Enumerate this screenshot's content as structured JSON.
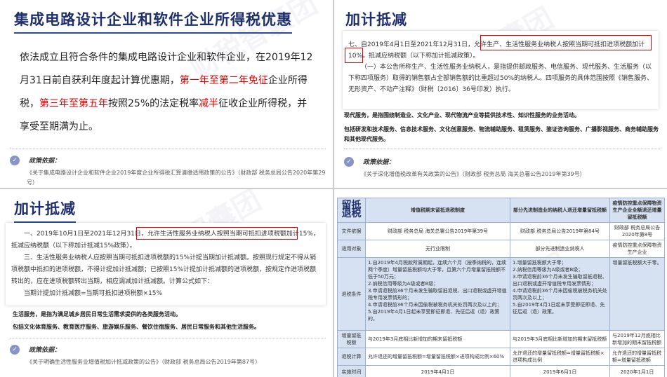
{
  "panel1": {
    "title": "集成电路设计企业和软件企业所得税优惠",
    "para_a": "依法成立且符合条件的集成电路设计企业和软件企业，在2019年12月31日前自获利年度起计算优惠期，",
    "red1": "第一年至第二年免征",
    "para_b": "企业所得税，",
    "red2": "第三年至第五年",
    "para_c": "按照25%的法定税率",
    "red3": "减半",
    "para_d": "征收企业所得税，并享受至期满为止。",
    "footnote_label": "政策依据：",
    "footnote_text": "《关于集成电路设计企业和软件企业2019年度企业所得税汇算清缴适用政策的公告》（财政部 税务总局公告2020年第29号）"
  },
  "panel2": {
    "title": "加计抵减",
    "para1_a": "七、自2019年4月1日至2021年12月31日，",
    "para1_box": "允许生产、生活性服务业纳税人按照当期可抵扣进项税额加计",
    "para1_pct": "10%",
    "para1_b": "，抵减应纳税额（以下称加计抵减政策）。",
    "para2": "（一）本公告所称生产、生活性服务业纳税人，是指提供邮政服务、电信服务、现代服务、生活服务（以下称四项服务）取得的销售额占全部销售额的比重超过50%的纳税人。四项服务的具体范围按照《销售服务、无形资产、不动产注释》（财税〔2016〕36号印发）执行。",
    "line1": "现代服务，是指围绕制造业、文化产业、现代物流产业等提供技术性、知识性服务的业务活动。",
    "line2": "包括研发和技术服务、信息技术服务、文化创意服务、物流辅助服务、租赁服务、鉴证咨询服务、广播影视服务、商务辅助服务和其他现代服务。",
    "footnote_label": "政策依据：",
    "footnote_text": "《关于深化增值税改革有关政策的公告》（财政部 税务总局 海关总署公告2019年第39号）"
  },
  "panel3": {
    "title": "加计抵减",
    "para1_a": "一、2019年10月1日至2021年12月31日，",
    "para1_box": "允许生活性服务业纳税人按照当期可抵扣进项税额加计15%",
    "para1_b": "，抵减应纳税额（以下称加计抵减15%政策）。",
    "para2": "三、生活性服务业纳税人应按照当期可抵扣进项税额的15%计提当期加计抵减额。按照现行规定不得从销项税额中抵扣的进项税额，不得计提加计抵减额；已按照15%计提加计抵减额的进项税额，按规定作进项税额转出的，应在进项税额转出当期，相应调减加计抵减额。计算公式如下：",
    "formula": "当期计提加计抵减额=当期可抵扣进项税额×15%",
    "line1": "生活服务，是指为满足城乡居民日常生活需求提供的各类服务活动。",
    "line2": "包括文化体育服务、教育医疗服务、旅游娱乐服务、餐饮住宿服务、居民日常服务和其他生活服务。",
    "footnote_label": "政策依据：",
    "footnote_text": "《关于明确生活性服务业增值税加计抵减政策的公告》（财政部 税务总局公告2019年第87号）"
  },
  "panel4": {
    "title": "留抵退税",
    "headers": [
      "增值税期末留抵退税制度",
      "部分先进制造业的纳税人退还增量留抵税额",
      "疫情防控重点保障物资生产企业全额退还增量留抵税额"
    ],
    "rows": [
      {
        "label": "文件依据",
        "cells": [
          "财政部 税务总局 海关总署公告2019年第39号",
          "财政部 税务总局公告2019年第84号",
          "财政部 税务总局公告2020年第8号"
        ]
      },
      {
        "label": "适用对象",
        "cells": [
          "无行业限制",
          "部分先进制造业纳税人",
          "疫情防控重点保障物资生产企业"
        ]
      },
      {
        "label": "退税条件",
        "cells": [
          "1.自2019年4月税款所属期起，连续六个月（按季纳税的，连续两个季度）增量留抵税额均大于零，且第六个月增量留抵税额不低于50万元；\n2.纳税信用等级为A级或者B级；\n3.申请退税前36个月未发生骗取留抵退税、出口退税或虚开增值税专用发票情形的；\n4.申请退税前36个月未因偷税被税务机关处罚两次及以上的；\n5.自2019年4月1日起未享受即征即退、先征后返（退）政策的。",
          "1.增量留抵税额大于零；\n2.纳税信用等级为A级或者B级；\n3.申请退税前36个月未发生骗取留抵退税、出口退税或虚开增值税专用发票情形；\n4.申请退税前36个月未因偷税被税务机关处罚两次及以上；\n5.自2019年4月1日起未享受即征即退、先征后返（退）政策。",
          "增量留抵税额大于零。"
        ]
      },
      {
        "label": "增量留抵税额",
        "cells": [
          "与2019年3月底相比新增加的期末留抵税额",
          "与2019年3月底相比新增加的期末留抵税额",
          "与2019年12月底相比新增加的期末留抵税额"
        ]
      },
      {
        "label": "退税计算",
        "cells": [
          "允许退还的增量留抵税额=增量留抵税额×进项构成比例×60%",
          "允许退还的增量留抵税额=增量留抵税额×进项构成比例",
          "允许退还的增量留抵税额=增量留抵税额"
        ]
      },
      {
        "label": "实施时间",
        "cells": [
          "2019年4月1日",
          "2019年6月1日",
          "2020年1月1日"
        ]
      }
    ]
  },
  "watermark": "财税智囊团"
}
